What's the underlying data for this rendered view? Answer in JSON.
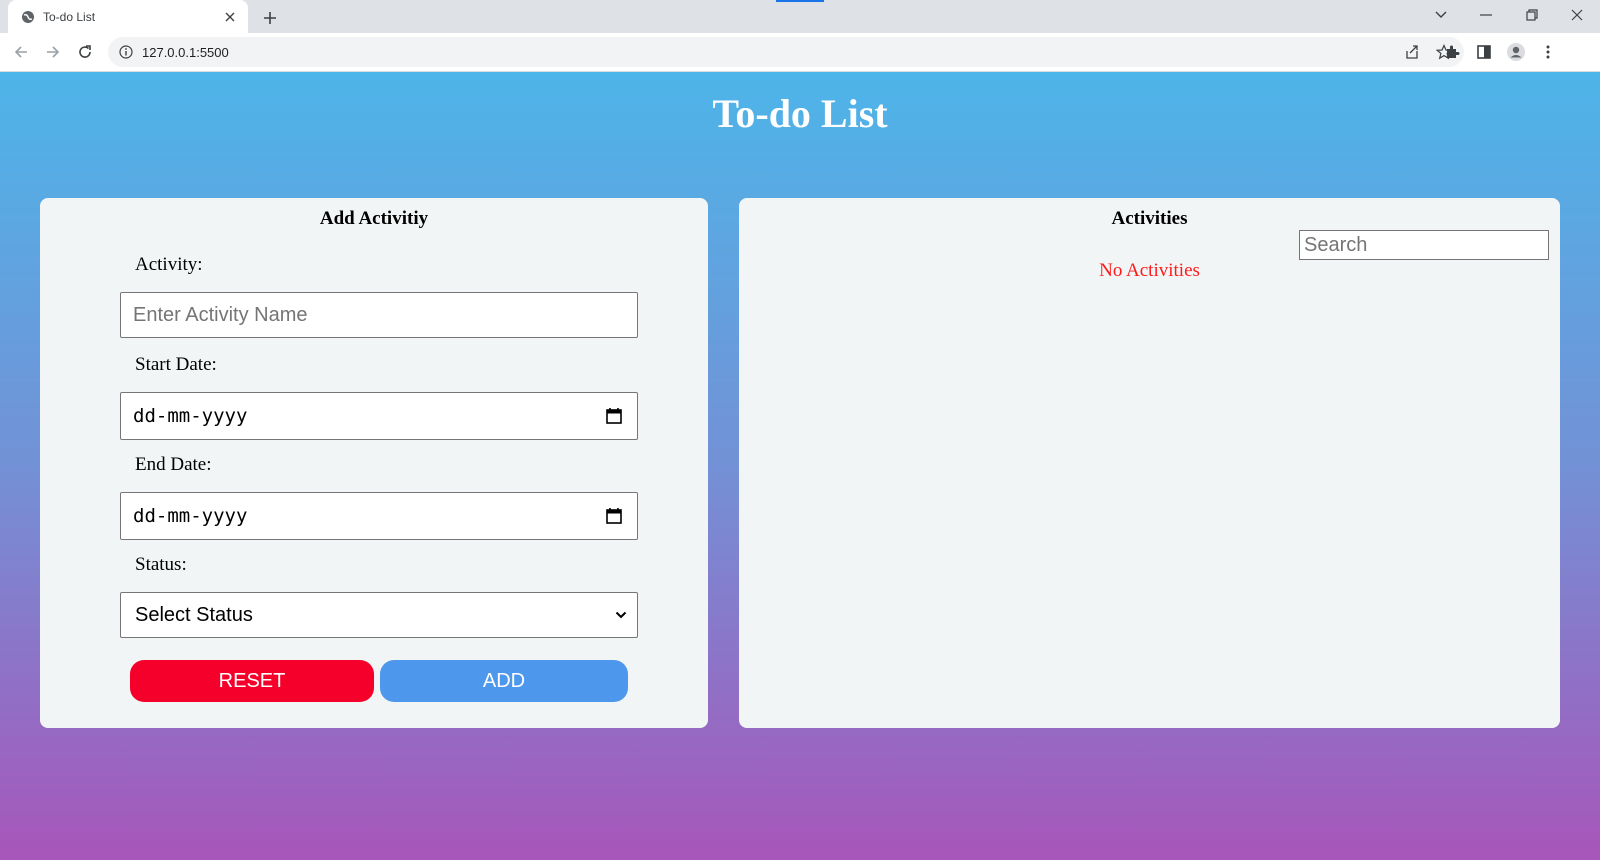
{
  "browser": {
    "tab_title": "To-do List",
    "url": "127.0.0.1:5500"
  },
  "page": {
    "title": "To-do List"
  },
  "add_form": {
    "heading": "Add Activitiy",
    "activity_label": "Activity:",
    "activity_placeholder": "Enter Activity Name",
    "activity_value": "",
    "start_label": "Start Date:",
    "start_value": "dd-mm-yyyy",
    "end_label": "End Date:",
    "end_value": "dd-mm-yyyy",
    "status_label": "Status:",
    "status_selected": "Select Status",
    "reset_label": "RESET",
    "add_label": "ADD"
  },
  "activities": {
    "heading": "Activities",
    "search_placeholder": "Search",
    "empty_message": "No Activities"
  },
  "colors": {
    "gradient_top": "#4db5e9",
    "gradient_bottom": "#a756b9",
    "reset_button": "#f5002a",
    "add_button": "#4d98ec",
    "empty_message": "#ff1a1a"
  }
}
